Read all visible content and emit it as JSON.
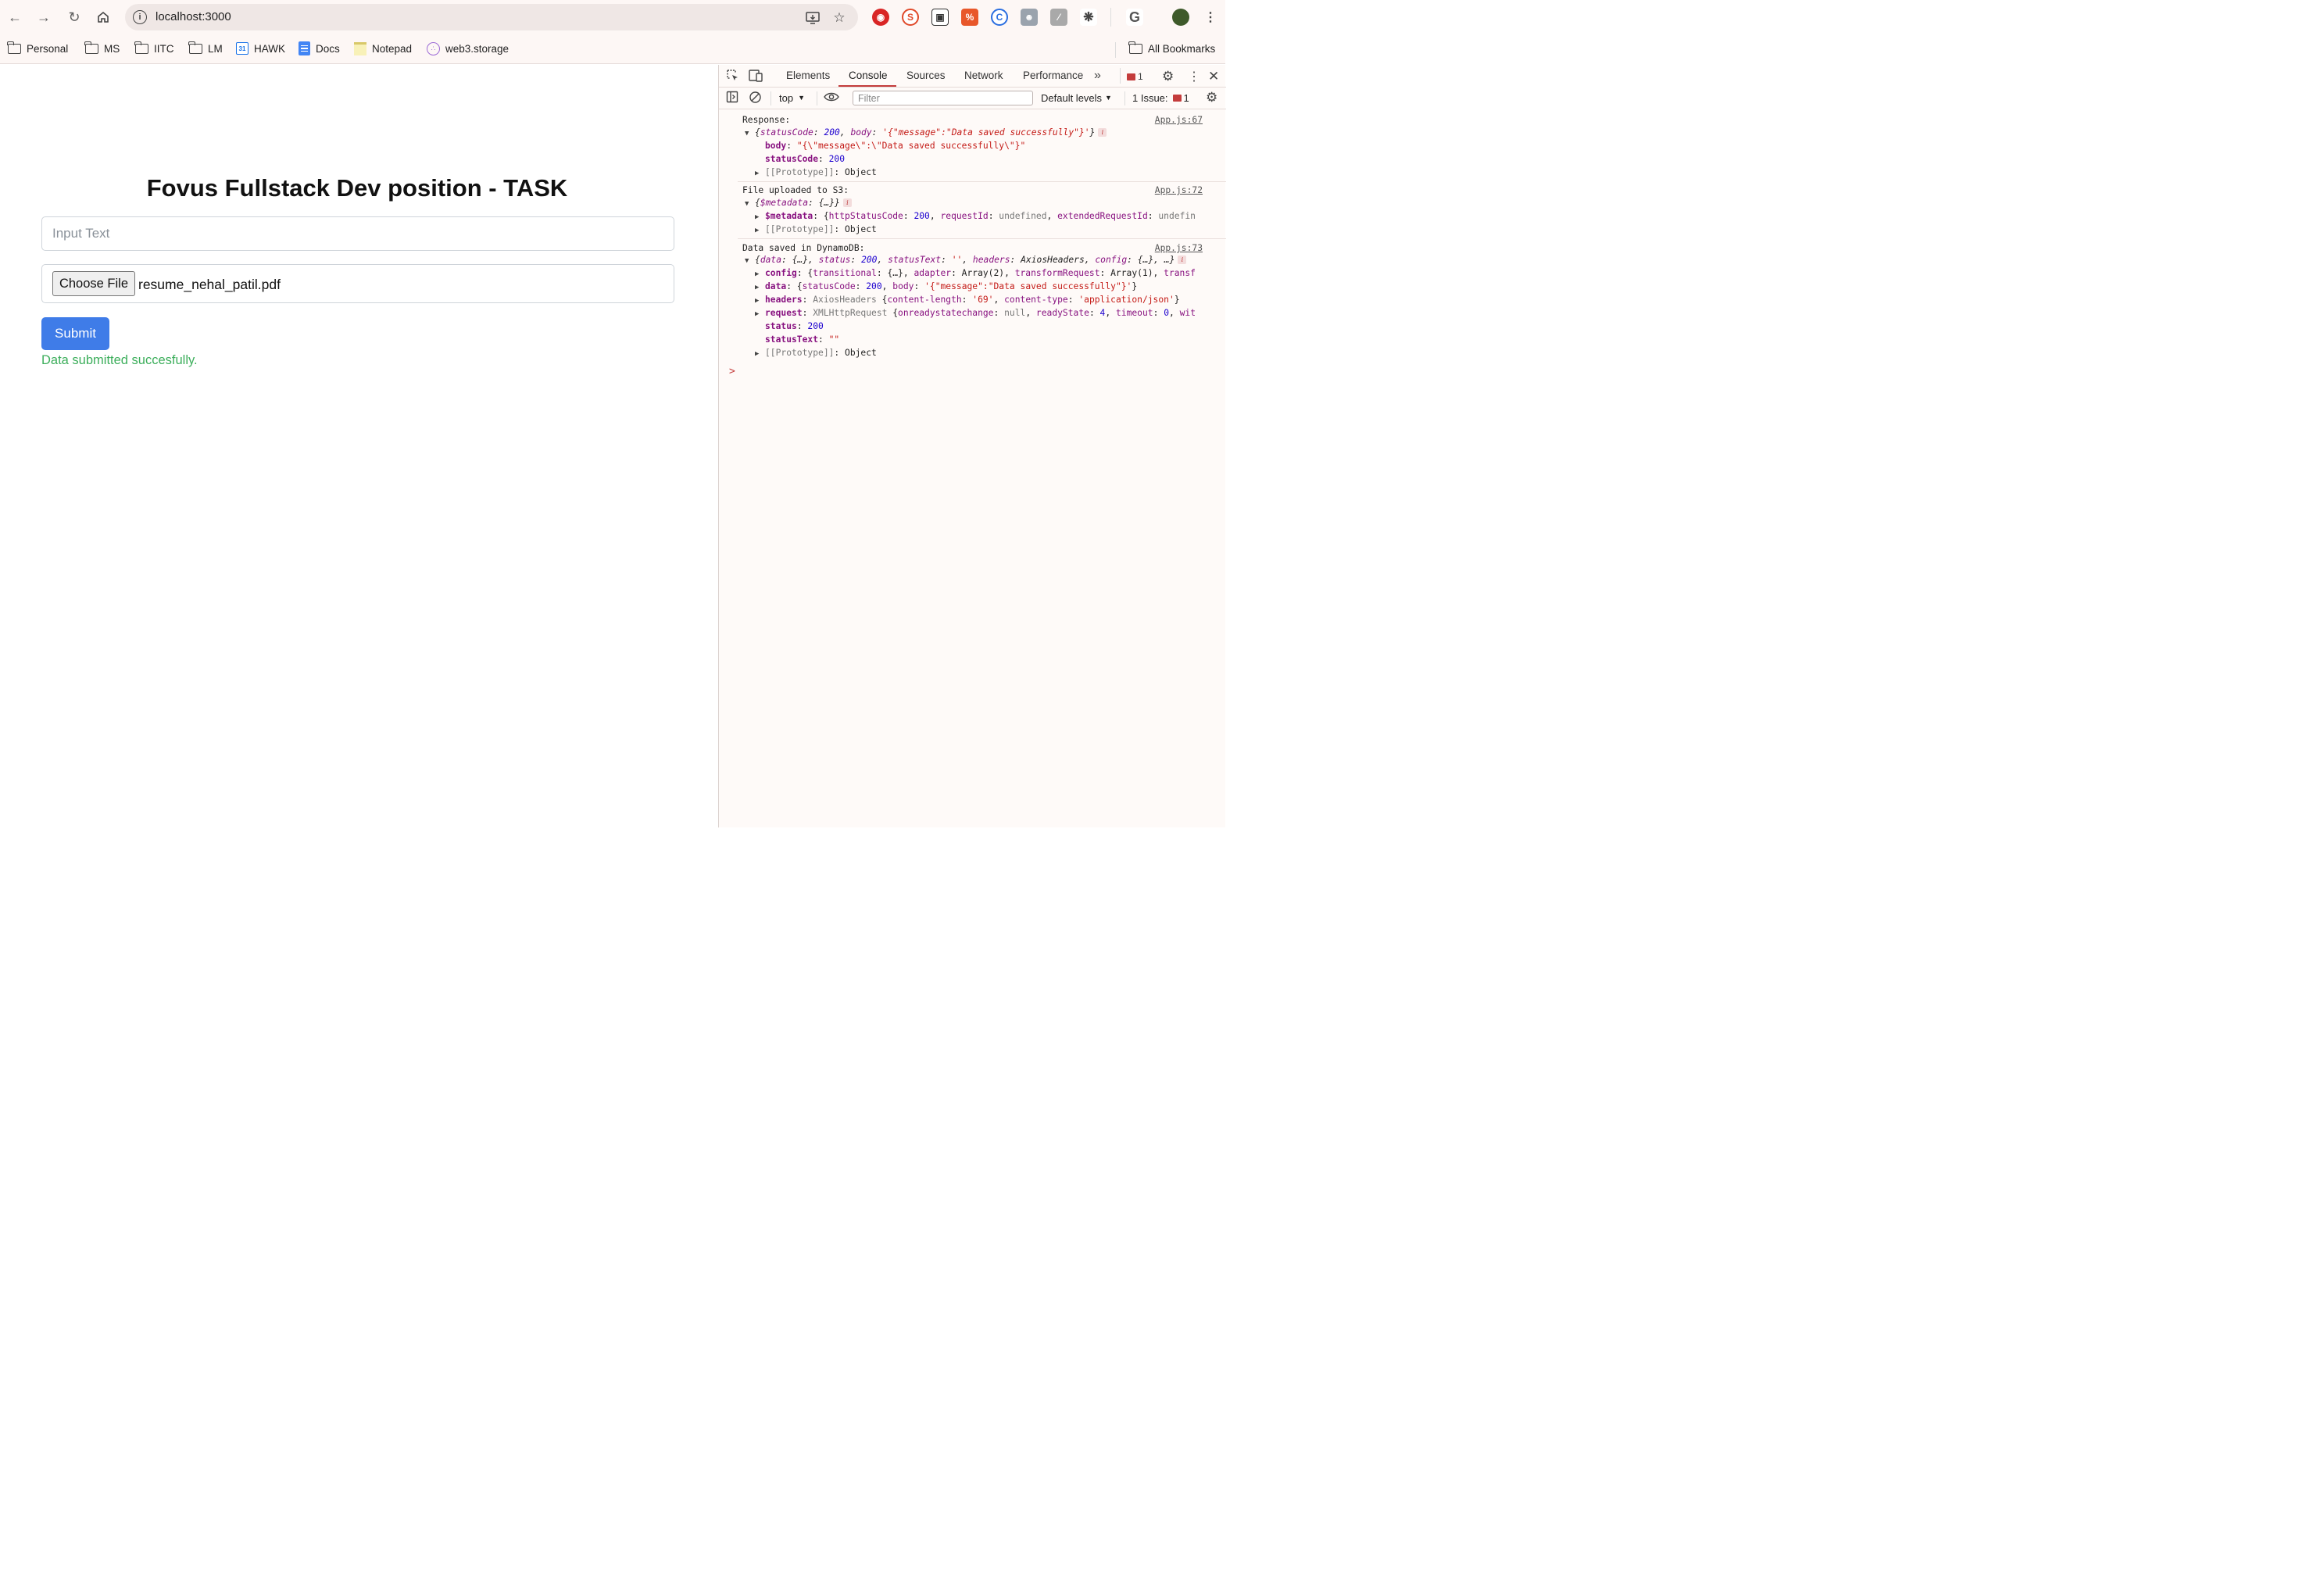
{
  "browser": {
    "url": "localhost:3000",
    "bookmarks": [
      {
        "label": "Personal",
        "icon": "folder-icon"
      },
      {
        "label": "MS",
        "icon": "folder-icon"
      },
      {
        "label": "IITC",
        "icon": "folder-icon"
      },
      {
        "label": "LM",
        "icon": "folder-icon"
      },
      {
        "label": "HAWK",
        "icon": "calendar-icon"
      },
      {
        "label": "Docs",
        "icon": "docs-icon"
      },
      {
        "label": "Notepad",
        "icon": "notepad-icon"
      },
      {
        "label": "web3.storage",
        "icon": "web3-icon"
      }
    ],
    "all_bookmarks": "All Bookmarks"
  },
  "page": {
    "title": "Fovus Fullstack Dev position - TASK",
    "input_placeholder": "Input Text",
    "choose_file_label": "Choose File",
    "file_name": "resume_nehal_patil.pdf",
    "submit_label": "Submit",
    "success_message": "Data submitted succesfully."
  },
  "devtools": {
    "tabs": [
      "Elements",
      "Console",
      "Sources",
      "Network",
      "Performance"
    ],
    "active_tab": "Console",
    "message_count": "1",
    "context": "top",
    "filter_placeholder": "Filter",
    "levels": "Default levels",
    "issues_label": "1 Issue:",
    "issues_count": "1",
    "logs": [
      {
        "source": "App.js:67",
        "header": "Response:"
      },
      {
        "source": "App.js:72",
        "header": "File uploaded to S3:"
      },
      {
        "source": "App.js:73",
        "header": "Data saved in DynamoDB:"
      }
    ],
    "prompt": ">"
  },
  "colors": {
    "submit": "#3f7ce8",
    "success": "#3cae5b",
    "devtools_accent": "#c43c3c"
  }
}
